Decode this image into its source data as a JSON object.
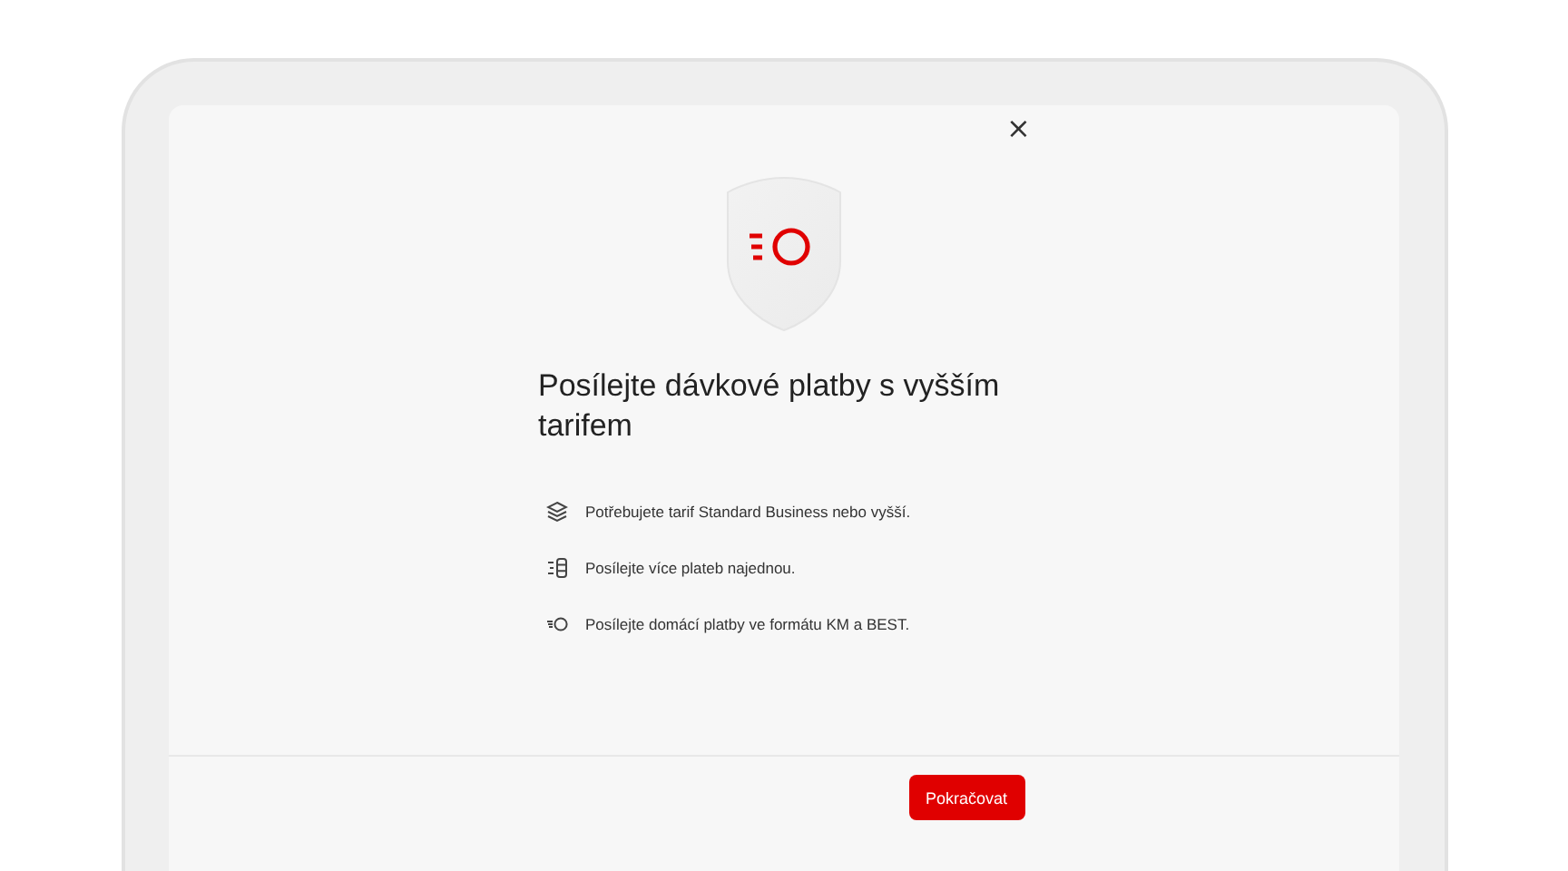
{
  "dialog": {
    "close": "×",
    "title": "Posílejte dávkové platby s vyšším tarifem",
    "features": [
      {
        "kind": "layers",
        "text": "Potřebujete tarif Standard Business nebo vyšší."
      },
      {
        "kind": "batch",
        "text": "Posílejte více plateb najednou."
      },
      {
        "kind": "speed",
        "text": "Posílejte domácí platby ve formátu KM a BEST."
      }
    ],
    "button": "Pokračovat"
  }
}
